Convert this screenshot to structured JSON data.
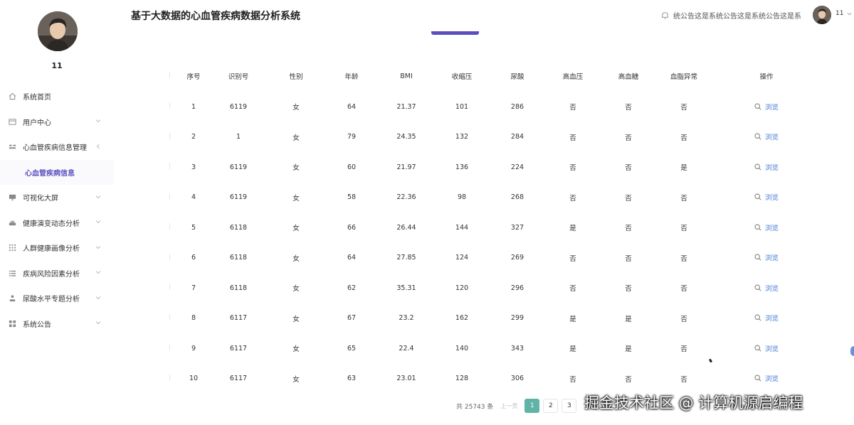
{
  "sidebar": {
    "username": "11",
    "items": [
      {
        "label": "系统首页",
        "icon": "home-icon",
        "has_chevron": false
      },
      {
        "label": "用户中心",
        "icon": "user-card-icon",
        "has_chevron": true
      },
      {
        "label": "心血管疾病信息管理",
        "icon": "heart-grid-icon",
        "has_chevron": true,
        "expanded": true,
        "sub_items": [
          {
            "label": "心血管疾病信息",
            "active": true
          }
        ]
      },
      {
        "label": "可视化大屏",
        "icon": "screen-icon",
        "has_chevron": true
      },
      {
        "label": "健康演变动态分析",
        "icon": "chart-bars-icon",
        "has_chevron": true
      },
      {
        "label": "人群健康画像分析",
        "icon": "dots-grid-icon",
        "has_chevron": true
      },
      {
        "label": "疾病风险因素分析",
        "icon": "list-icon",
        "has_chevron": true
      },
      {
        "label": "尿酸水平专题分析",
        "icon": "person-icon",
        "has_chevron": true
      },
      {
        "label": "系统公告",
        "icon": "apps-grid-icon",
        "has_chevron": true
      }
    ]
  },
  "header": {
    "title": "基于大数据的心血管疾病数据分析系统",
    "notice": "统公告这是系统公告这是系统公告这是系统公告",
    "username": "11"
  },
  "table": {
    "columns": [
      "序号",
      "识别号",
      "性别",
      "年龄",
      "BMI",
      "收缩压",
      "尿酸",
      "高血压",
      "高血糖",
      "血脂异常",
      "操作"
    ],
    "action_label": "浏览",
    "rows": [
      [
        "1",
        "6119",
        "女",
        "64",
        "21.37",
        "101",
        "286",
        "否",
        "否",
        "否"
      ],
      [
        "2",
        "1",
        "女",
        "79",
        "24.35",
        "132",
        "284",
        "否",
        "否",
        "否"
      ],
      [
        "3",
        "6119",
        "女",
        "60",
        "21.97",
        "136",
        "224",
        "否",
        "否",
        "是"
      ],
      [
        "4",
        "6119",
        "女",
        "58",
        "22.36",
        "98",
        "268",
        "否",
        "否",
        "否"
      ],
      [
        "5",
        "6118",
        "女",
        "66",
        "26.44",
        "144",
        "327",
        "是",
        "否",
        "否"
      ],
      [
        "6",
        "6118",
        "女",
        "64",
        "27.85",
        "124",
        "269",
        "否",
        "否",
        "否"
      ],
      [
        "7",
        "6118",
        "女",
        "62",
        "35.31",
        "120",
        "296",
        "否",
        "否",
        "否"
      ],
      [
        "8",
        "6117",
        "女",
        "67",
        "23.2",
        "162",
        "299",
        "是",
        "是",
        "否"
      ],
      [
        "9",
        "6117",
        "女",
        "65",
        "22.4",
        "140",
        "343",
        "是",
        "是",
        "否"
      ],
      [
        "10",
        "6117",
        "女",
        "63",
        "23.01",
        "128",
        "306",
        "否",
        "否",
        "否"
      ]
    ]
  },
  "pagination": {
    "total_text": "共 25743 条",
    "prev_label": "上一页",
    "pages": [
      "1",
      "2",
      "3"
    ],
    "current": "1"
  },
  "watermark": "掘金技术社区 @ 计算机源启编程",
  "colors": {
    "accent": "#5b4fbf",
    "active_page": "#5fb3a7",
    "link": "#4a7fd6"
  }
}
